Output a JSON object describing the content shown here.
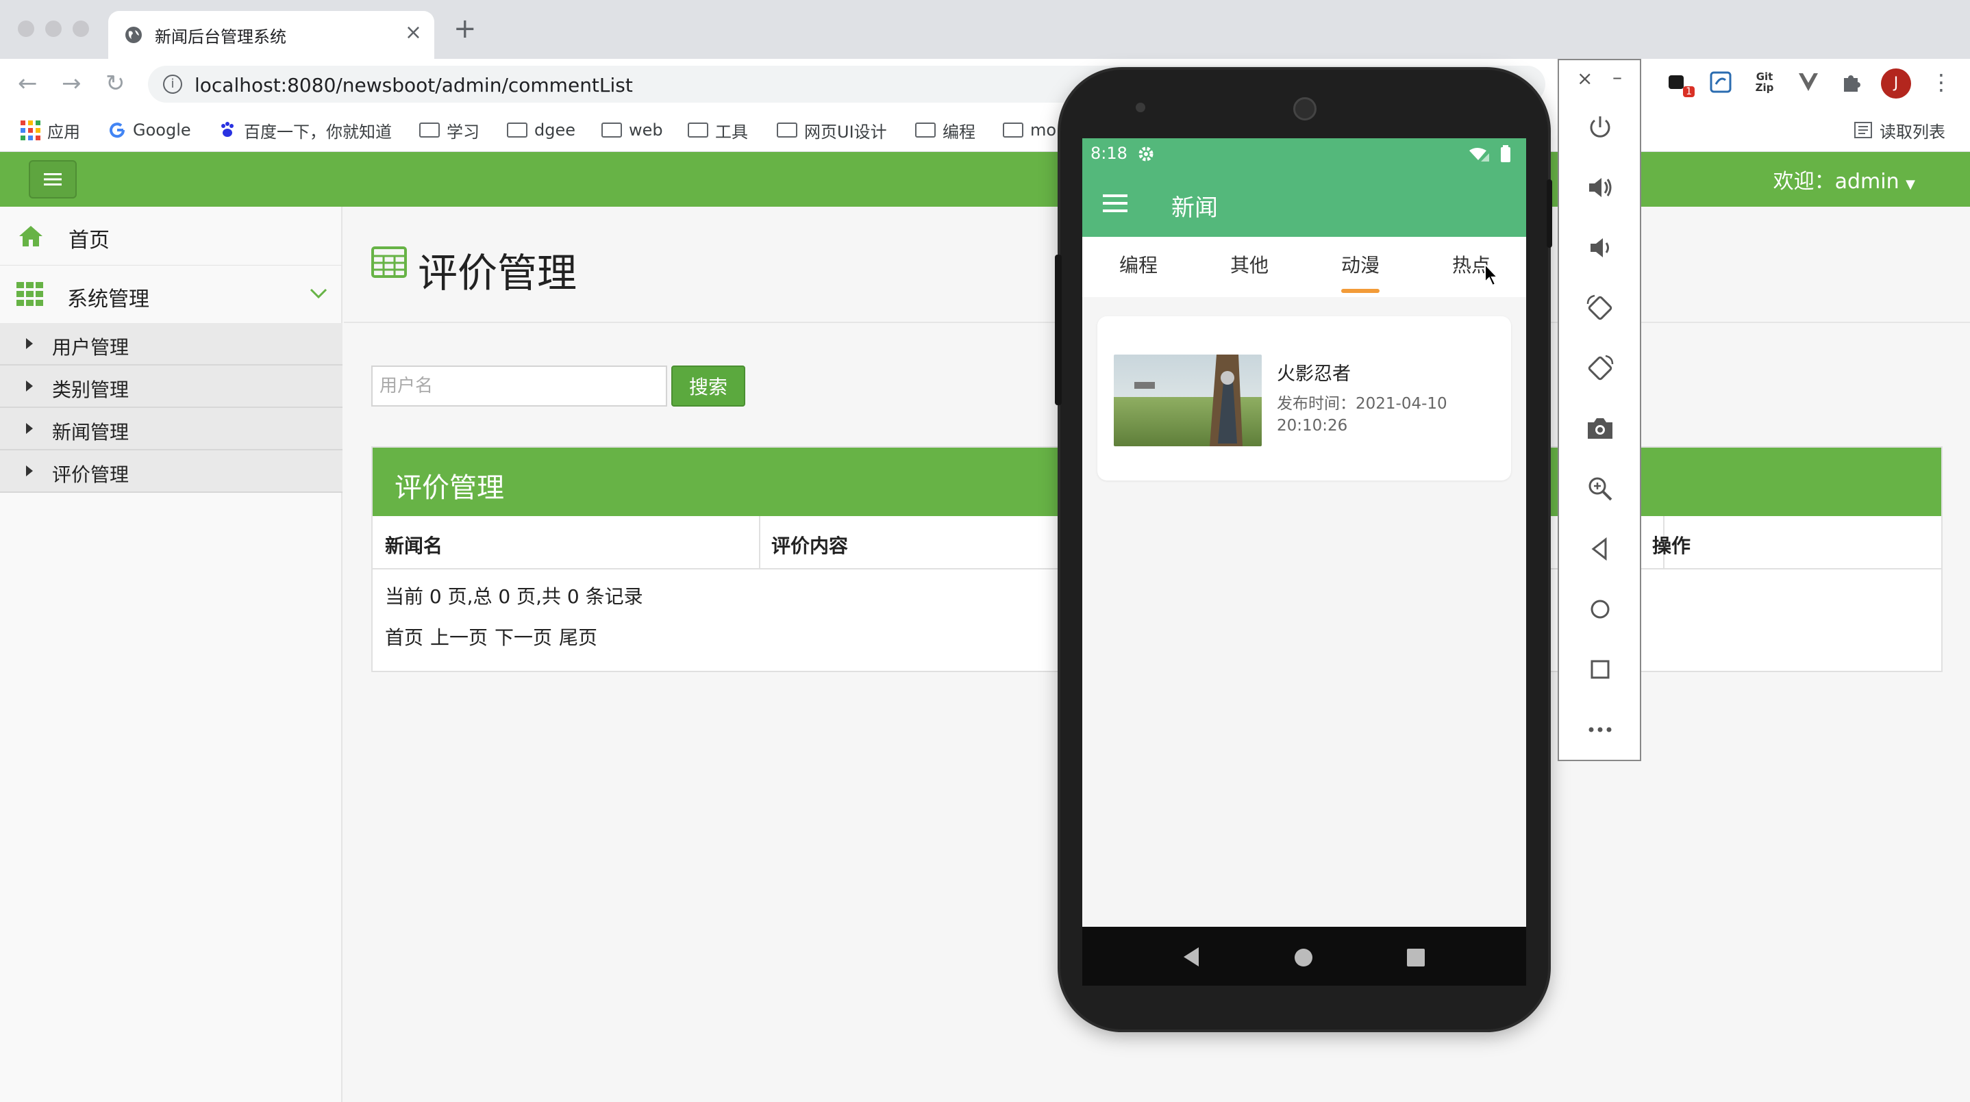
{
  "browser": {
    "tab_title": "新闻后台管理系统",
    "tab_close": "×",
    "new_tab": "+",
    "url": "localhost:8080/newsboot/admin/commentList",
    "bookmarks": [
      {
        "label": "应用"
      },
      {
        "label": "Google"
      },
      {
        "label": "百度一下，你就知道"
      },
      {
        "label": "学习"
      },
      {
        "label": "dgee"
      },
      {
        "label": "web"
      },
      {
        "label": "工具"
      },
      {
        "label": "网页UI设计"
      },
      {
        "label": "编程"
      },
      {
        "label": "mo"
      }
    ],
    "reading_list": "读取列表",
    "profile_initial": "J",
    "ext_badge": "1",
    "ext_gitzip": "Git Zip"
  },
  "header": {
    "welcome": "欢迎：admin"
  },
  "sidebar": {
    "home": "首页",
    "system": "系统管理",
    "items": [
      {
        "label": "用户管理"
      },
      {
        "label": "类别管理"
      },
      {
        "label": "新闻管理"
      },
      {
        "label": "评价管理"
      }
    ]
  },
  "main": {
    "page_title": "评价管理",
    "search_placeholder": "用户名",
    "search_button": "搜索",
    "panel_title": "评价管理",
    "columns": [
      "新闻名",
      "评价内容",
      "操作"
    ],
    "pager_info": "当前 0 页,总 0 页,共 0 条记录",
    "pager_links": [
      "首页",
      "上一页",
      "下一页",
      "尾页"
    ]
  },
  "phone": {
    "time": "8:18",
    "app_title": "新闻",
    "tabs": [
      "编程",
      "其他",
      "动漫",
      "热点"
    ],
    "selected_tab": "动漫",
    "news": [
      {
        "title": "火影忍者",
        "time": "发布时间：2021-04-10 20:10:26"
      }
    ]
  },
  "colors": {
    "admin_green": "#67b346",
    "phone_green": "#54b87b",
    "tab_indicator": "#f29b38"
  }
}
